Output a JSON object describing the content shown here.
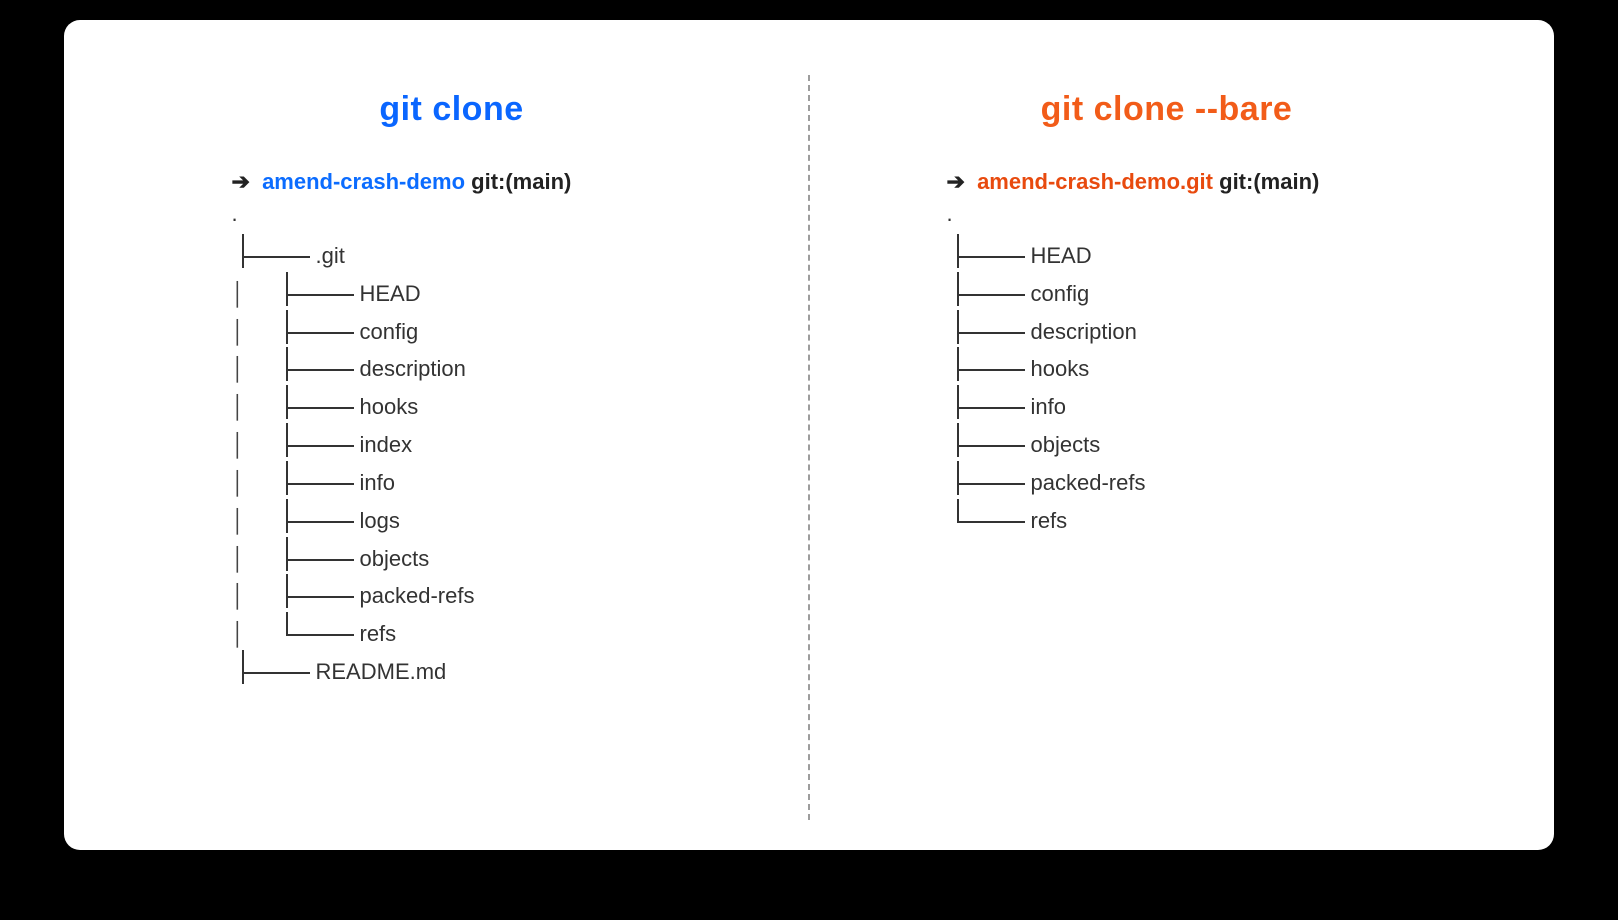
{
  "left": {
    "title": "git clone",
    "prompt_arrow": "➔",
    "repo": "amend-crash-demo",
    "git_suffix": " git:(main)",
    "root_dot": ".",
    "tree": [
      {
        "indent": 0,
        "kind": "tee",
        "name": ".git"
      },
      {
        "indent": 1,
        "kind": "tee",
        "name": "HEAD"
      },
      {
        "indent": 1,
        "kind": "tee",
        "name": "config"
      },
      {
        "indent": 1,
        "kind": "tee",
        "name": "description"
      },
      {
        "indent": 1,
        "kind": "tee",
        "name": "hooks"
      },
      {
        "indent": 1,
        "kind": "tee",
        "name": "index"
      },
      {
        "indent": 1,
        "kind": "tee",
        "name": "info"
      },
      {
        "indent": 1,
        "kind": "tee",
        "name": "logs"
      },
      {
        "indent": 1,
        "kind": "tee",
        "name": "objects"
      },
      {
        "indent": 1,
        "kind": "tee",
        "name": "packed-refs"
      },
      {
        "indent": 1,
        "kind": "end",
        "name": "refs"
      },
      {
        "indent": 0,
        "kind": "tee",
        "name": "README.md"
      }
    ]
  },
  "right": {
    "title": "git clone  --bare",
    "prompt_arrow": "➔",
    "repo": "amend-crash-demo.git",
    "git_suffix": " git:(main)",
    "root_dot": ".",
    "tree": [
      {
        "indent": 0,
        "kind": "tee",
        "name": "HEAD"
      },
      {
        "indent": 0,
        "kind": "tee",
        "name": "config"
      },
      {
        "indent": 0,
        "kind": "tee",
        "name": "description"
      },
      {
        "indent": 0,
        "kind": "tee",
        "name": "hooks"
      },
      {
        "indent": 0,
        "kind": "tee",
        "name": "info"
      },
      {
        "indent": 0,
        "kind": "tee",
        "name": "objects"
      },
      {
        "indent": 0,
        "kind": "tee",
        "name": "packed-refs"
      },
      {
        "indent": 0,
        "kind": "end",
        "name": "refs"
      }
    ]
  }
}
